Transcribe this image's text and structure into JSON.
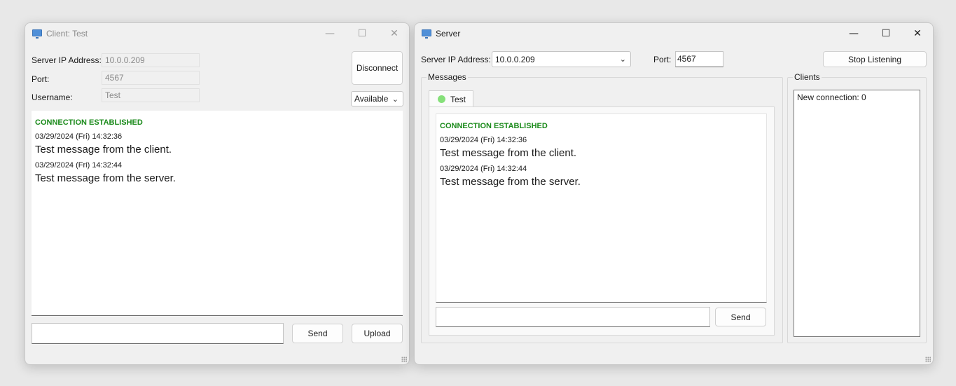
{
  "client": {
    "title": "Client: Test",
    "labels": {
      "server_ip": "Server IP Address:",
      "port": "Port:",
      "username": "Username:"
    },
    "values": {
      "server_ip": "10.0.0.209",
      "port": "4567",
      "username": "Test"
    },
    "disconnect_label": "Disconnect",
    "status_select": "Available",
    "chat": {
      "connection": "CONNECTION ESTABLISHED",
      "messages": [
        {
          "time": "03/29/2024 (Fri) 14:32:36",
          "text": "Test message from the client."
        },
        {
          "time": "03/29/2024 (Fri) 14:32:44",
          "text": "Test message from the server."
        }
      ]
    },
    "message_input": "",
    "send_label": "Send",
    "upload_label": "Upload"
  },
  "server": {
    "title": "Server",
    "labels": {
      "server_ip": "Server IP Address:",
      "port": "Port:"
    },
    "values": {
      "server_ip": "10.0.0.209",
      "port": "4567"
    },
    "stop_label": "Stop Listening",
    "messages_group": "Messages",
    "clients_group": "Clients",
    "tab": {
      "name": "Test",
      "status_color": "#86e07a"
    },
    "chat": {
      "connection": "CONNECTION ESTABLISHED",
      "messages": [
        {
          "time": "03/29/2024 (Fri) 14:32:36",
          "text": "Test message from the client."
        },
        {
          "time": "03/29/2024 (Fri) 14:32:44",
          "text": "Test message from the server."
        }
      ]
    },
    "message_input": "",
    "send_label": "Send",
    "clients": [
      "New connection: 0"
    ]
  },
  "icons": {
    "app": "app-window-icon",
    "minimize": "minimize-icon",
    "maximize": "maximize-icon",
    "close": "close-icon",
    "dropdown": "chevron-down-icon"
  },
  "colors": {
    "connection_text": "#1a8a1a",
    "window_bg": "#f0f0f0",
    "online_dot": "#86e07a"
  }
}
